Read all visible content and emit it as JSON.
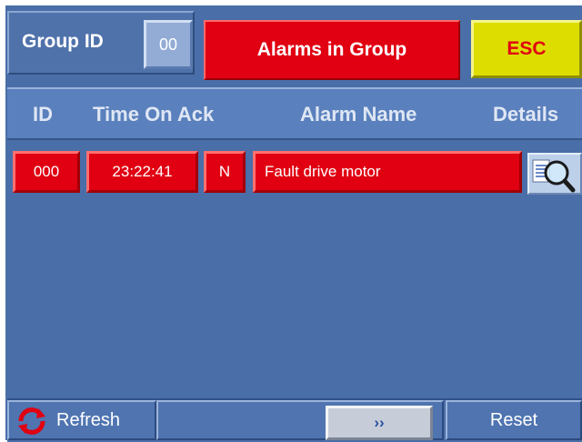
{
  "header": {
    "group_label": "Group ID",
    "group_id": "00",
    "title": "Alarms in Group",
    "esc_label": "ESC"
  },
  "columns": {
    "id": "ID",
    "time_on_ack": "Time On Ack",
    "alarm_name": "Alarm Name",
    "details": "Details"
  },
  "alarms": [
    {
      "id": "000",
      "time": "23:22:41",
      "ack": "N",
      "name": "Fault drive motor"
    }
  ],
  "footer": {
    "refresh_label": "Refresh",
    "next_label": "››",
    "reset_label": "Reset"
  },
  "colors": {
    "background": "#4a6ea8",
    "alarm_red": "#e00012",
    "esc_yellow": "#dddd00"
  },
  "icons": {
    "details": "magnifier-document-icon",
    "refresh": "refresh-arrows-icon"
  }
}
